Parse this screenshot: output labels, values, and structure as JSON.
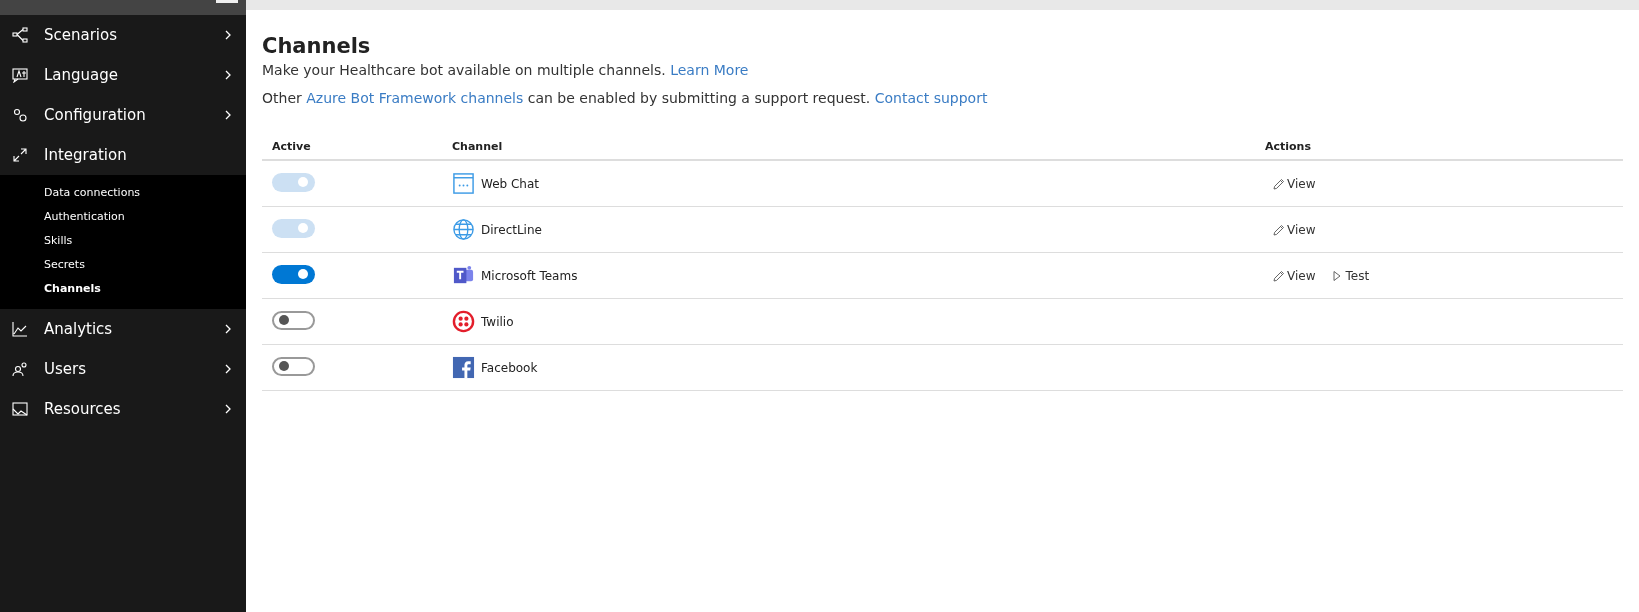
{
  "sidebar": {
    "items": [
      {
        "label": "Scenarios",
        "kind": "scenarios",
        "expanded": false
      },
      {
        "label": "Language",
        "kind": "language",
        "expanded": false
      },
      {
        "label": "Configuration",
        "kind": "configuration",
        "expanded": false
      },
      {
        "label": "Integration",
        "kind": "integration",
        "expanded": true,
        "children": [
          {
            "label": "Data connections",
            "selected": false
          },
          {
            "label": "Authentication",
            "selected": false
          },
          {
            "label": "Skills",
            "selected": false
          },
          {
            "label": "Secrets",
            "selected": false
          },
          {
            "label": "Channels",
            "selected": true
          }
        ]
      },
      {
        "label": "Analytics",
        "kind": "analytics",
        "expanded": false
      },
      {
        "label": "Users",
        "kind": "users",
        "expanded": false
      },
      {
        "label": "Resources",
        "kind": "resources",
        "expanded": false
      }
    ]
  },
  "page": {
    "title": "Channels",
    "paragraphs": [
      [
        {
          "kind": "text",
          "text": "Make your Healthcare bot available on multiple channels."
        },
        {
          "kind": "link",
          "text": "Learn More"
        }
      ],
      [
        {
          "kind": "text",
          "text": "Other"
        },
        {
          "kind": "link",
          "text": "Azure Bot Framework channels"
        },
        {
          "kind": "text",
          "text": "can be enabled by submitting a support request."
        },
        {
          "kind": "link",
          "text": "Contact support"
        }
      ]
    ]
  },
  "table": {
    "columns": [
      "Active",
      "Channel",
      "Actions"
    ],
    "rows": [
      {
        "on": true,
        "disabled": true,
        "kind": "webchat",
        "channel": "Web Chat",
        "actions": [
          {
            "kind": "edit",
            "label": "View"
          }
        ]
      },
      {
        "on": true,
        "disabled": true,
        "kind": "globe",
        "channel": "DirectLine",
        "actions": [
          {
            "kind": "edit",
            "label": "View"
          }
        ]
      },
      {
        "on": true,
        "disabled": false,
        "kind": "teams",
        "channel": "Microsoft Teams",
        "actions": [
          {
            "kind": "edit",
            "label": "View"
          },
          {
            "kind": "test",
            "label": "Test"
          }
        ]
      },
      {
        "on": false,
        "disabled": false,
        "kind": "twilio",
        "channel": "Twilio"
      },
      {
        "on": false,
        "disabled": false,
        "kind": "facebook",
        "channel": "Facebook"
      }
    ]
  }
}
